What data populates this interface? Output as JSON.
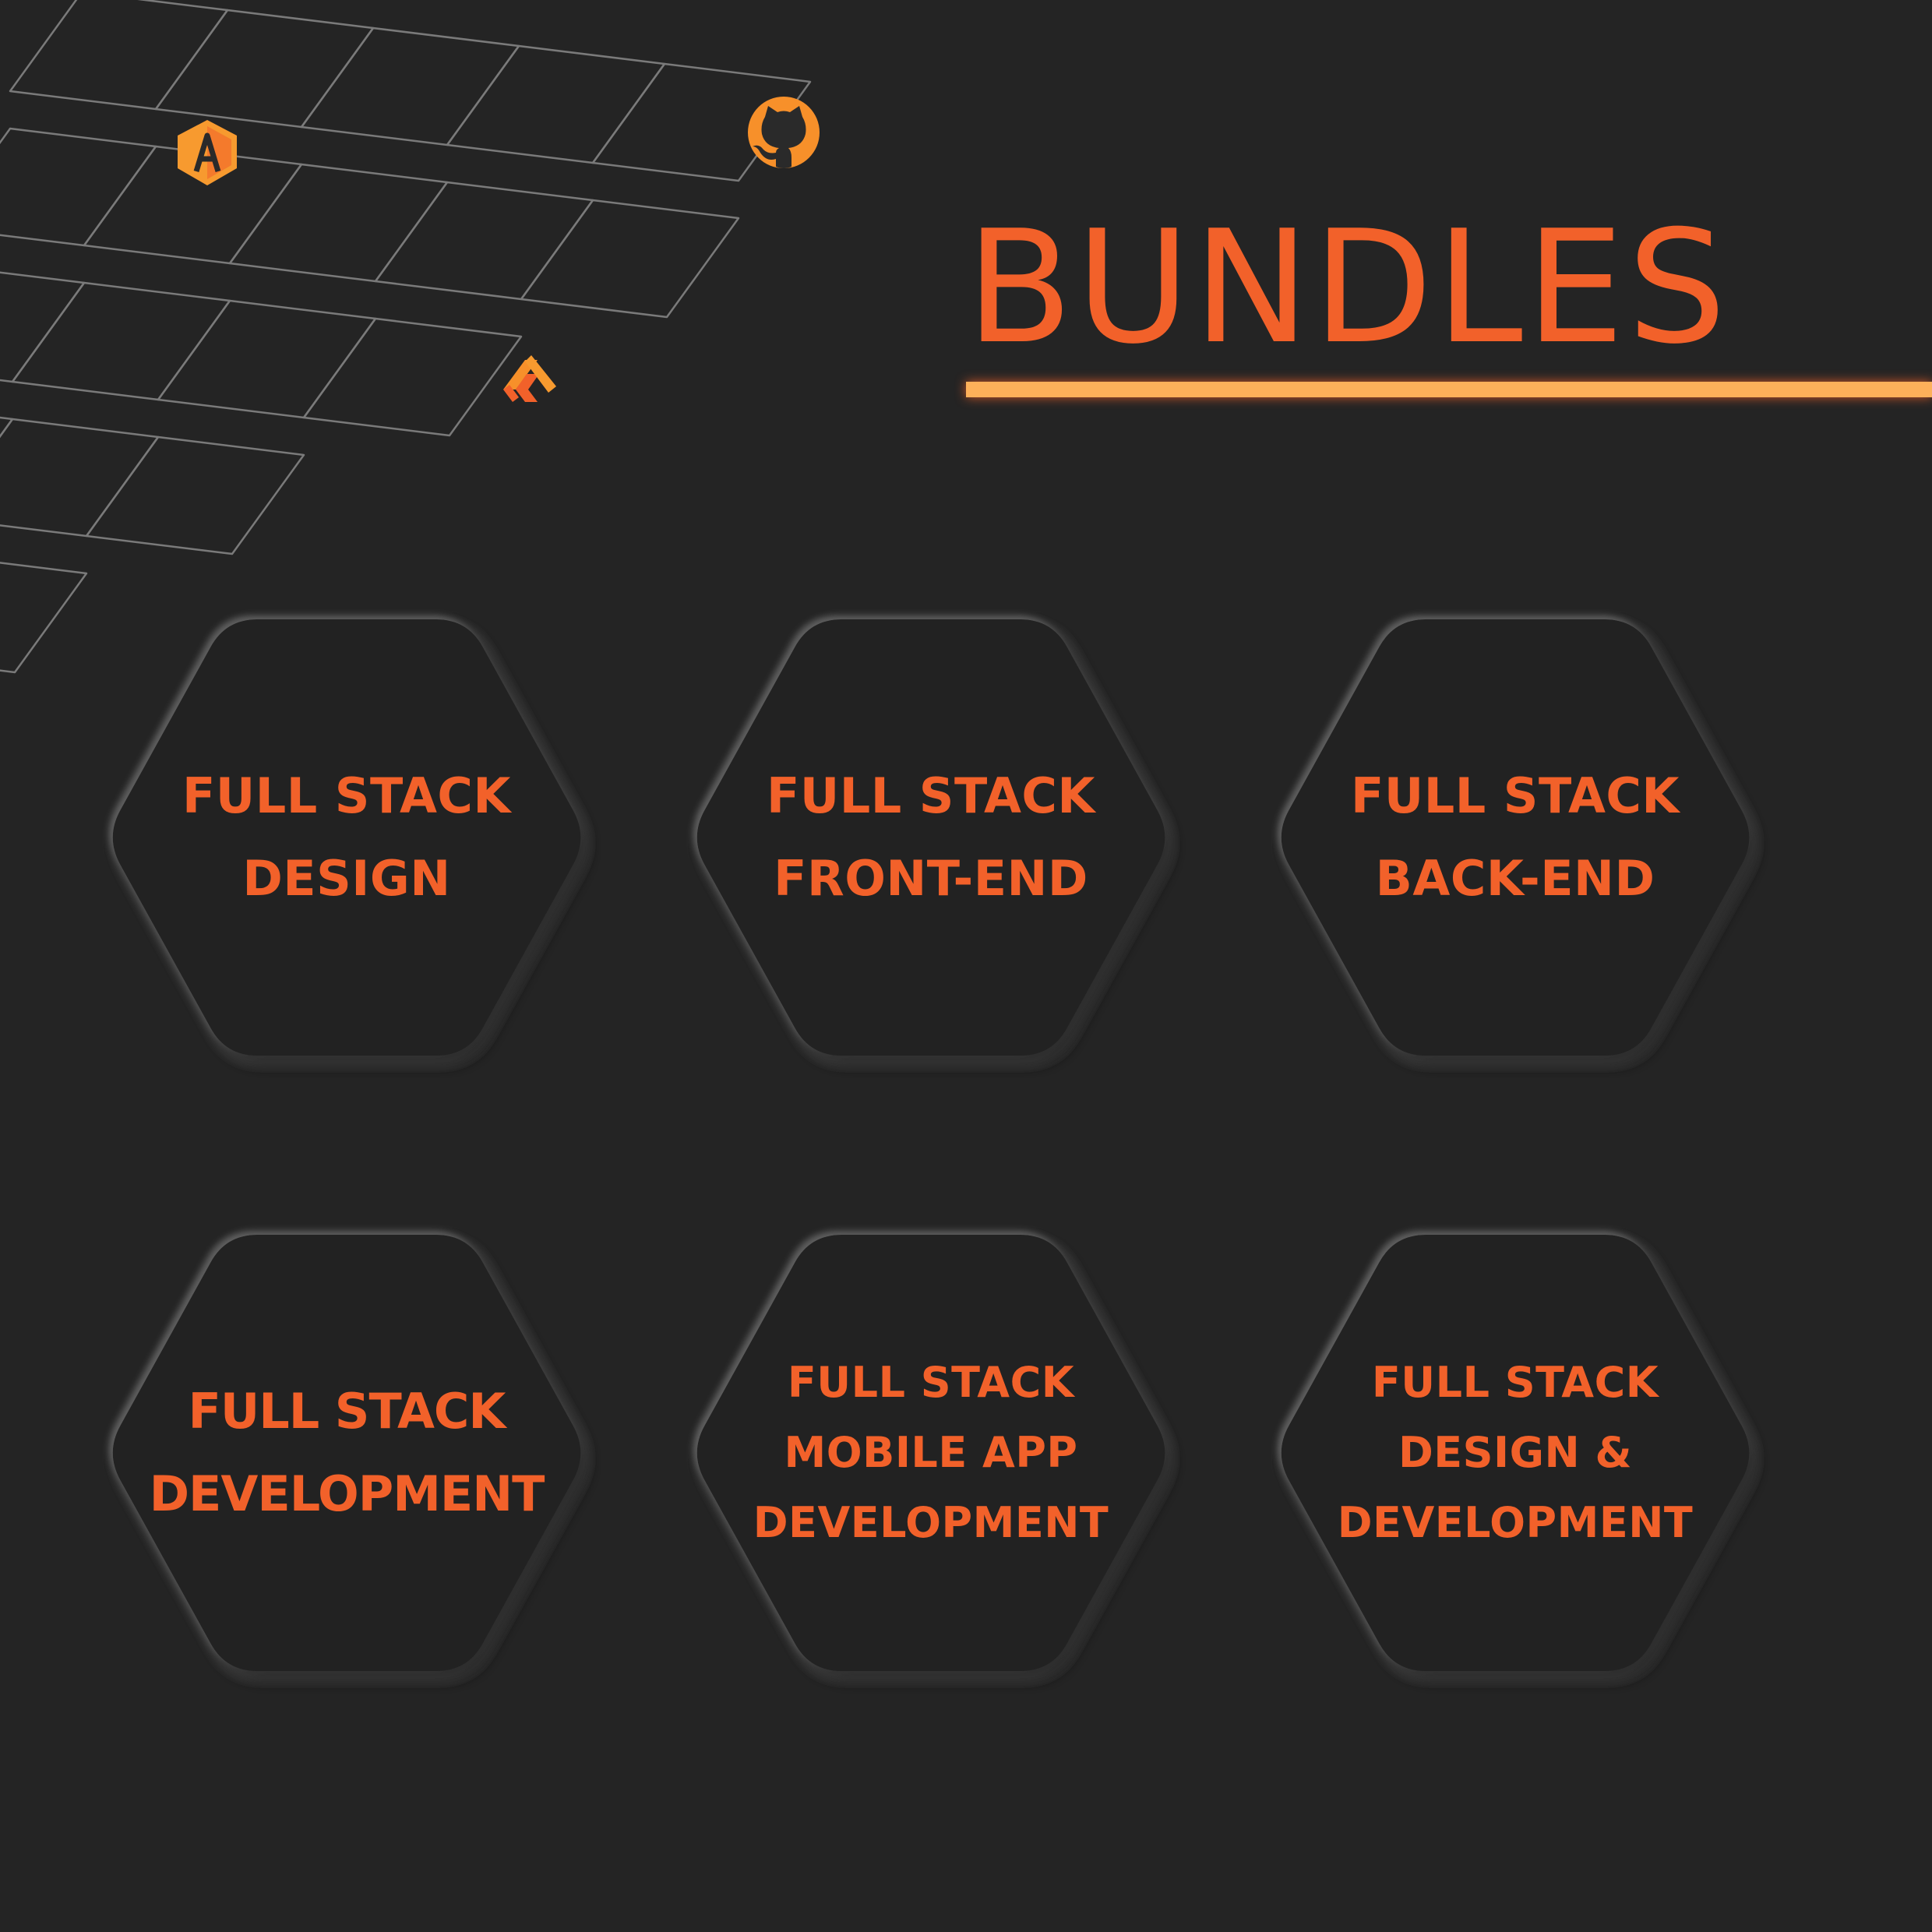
{
  "title": "BUNDLES",
  "bundles": [
    {
      "lines": [
        "FULL STACK",
        "DESIGN"
      ]
    },
    {
      "lines": [
        "FULL STACK",
        "FRONT-END"
      ]
    },
    {
      "lines": [
        "FULL STACK",
        "BACK-END"
      ]
    },
    {
      "lines": [
        "FULL STACK",
        "DEVELOPMENT"
      ]
    },
    {
      "lines": [
        "FULL STACK",
        "MOBILE APP",
        "DEVELOPMENT"
      ]
    },
    {
      "lines": [
        "FULL STACK",
        "DESIGN &",
        "DEVELOPMENT"
      ]
    }
  ],
  "icons": [
    "angular-icon",
    "github-icon",
    "flutter-icon"
  ],
  "colors": {
    "background": "#242424",
    "accent": "#f2612a",
    "underline": "#fdb05a",
    "pattern_stroke": "#8a8a8a"
  }
}
